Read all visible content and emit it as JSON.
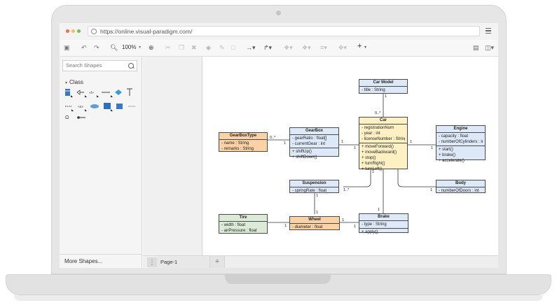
{
  "browser": {
    "url": "https://online.visual-paradigm.com/"
  },
  "toolbar": {
    "zoom": "100%"
  },
  "sidebar": {
    "search_placeholder": "Search Shapes",
    "category": "Class",
    "more_shapes": "More Shapes..."
  },
  "pages": {
    "tab_label": "Page-1"
  },
  "diagram": {
    "classes": {
      "car_model": {
        "name": "Car Model",
        "attributes": [
          "- title : String"
        ],
        "operations": []
      },
      "car": {
        "name": "Car",
        "attributes": [
          "- registrationNum",
          "- year : int",
          "- licenseNumber : String"
        ],
        "operations": [
          "+ moveForward()",
          "+ moveBackward()",
          "+ stop()",
          "+ turnRight()",
          "+ turnLeft()"
        ]
      },
      "gearbox_type": {
        "name": "GearBoxType",
        "attributes": [
          "- name : String",
          "- remarks : String"
        ],
        "operations": []
      },
      "gearbox": {
        "name": "GearBox",
        "attributes": [
          "- gearRatio : float[]",
          "- currentGear : int"
        ],
        "operations": [
          "+ shiftUp()",
          "+ shiftDown()"
        ]
      },
      "engine": {
        "name": "Engine",
        "attributes": [
          "- capacity : float",
          "- numberOfCylinders : int"
        ],
        "operations": [
          "+ start()",
          "+ brake()",
          "+ accelerate()"
        ]
      },
      "suspension": {
        "name": "Suspension",
        "attributes": [
          "- springRate : float"
        ],
        "operations": []
      },
      "body": {
        "name": "Body",
        "attributes": [
          "- numberOfDoors : int"
        ],
        "operations": []
      },
      "tire": {
        "name": "Tire",
        "attributes": [
          "- width : float",
          "- airPressure : float"
        ],
        "operations": []
      },
      "wheel": {
        "name": "Wheel",
        "attributes": [
          "- diameter : float"
        ],
        "operations": []
      },
      "brake": {
        "name": "Brake",
        "attributes": [
          "- type : String"
        ],
        "operations": [
          "+ apply()"
        ]
      }
    },
    "multiplicities": {
      "carmodel_car_top": "1",
      "carmodel_car_bottom": "0..*",
      "gbtype_left": "0..*",
      "gbtype_right": "1",
      "gearbox_car_left": "1",
      "gearbox_car_right": "1",
      "car_engine_left": "1",
      "car_engine_right": "1",
      "car_susp_top": "1",
      "car_susp_left": "1..*",
      "car_body": "1",
      "car_brake": "1",
      "susp_wheel_top": "1",
      "susp_wheel_bottom": "1",
      "tire_wheel": "1",
      "wheel_brake_left": "1",
      "wheel_brake_right": "1"
    }
  },
  "colors": {
    "class_blue": "#dde8f8",
    "class_yellow": "#fdf1c4",
    "class_orange": "#fad2a6",
    "class_green": "#dcebd8"
  }
}
